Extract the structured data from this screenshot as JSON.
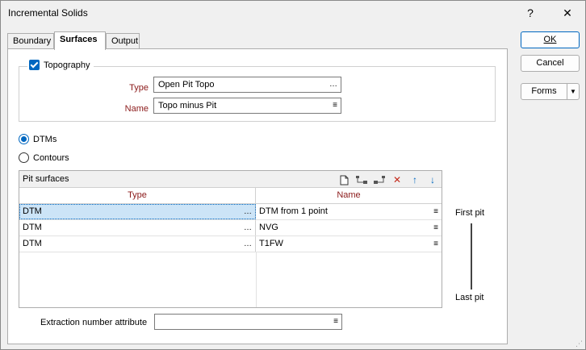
{
  "window": {
    "title": "Incremental Solids",
    "help_icon": "?",
    "close_icon": "✕"
  },
  "tabs": [
    {
      "label": "Boundary"
    },
    {
      "label": "Surfaces"
    },
    {
      "label": "Output"
    }
  ],
  "topography": {
    "label": "Topography",
    "checked": true,
    "type_label": "Type",
    "type_value": "Open Pit Topo",
    "name_label": "Name",
    "name_value": "Topo minus Pit"
  },
  "mode": {
    "dtms_label": "DTMs",
    "contours_label": "Contours",
    "selected": "DTMs"
  },
  "pit_surfaces": {
    "title": "Pit surfaces",
    "columns": {
      "type": "Type",
      "name": "Name"
    },
    "rows": [
      {
        "type": "DTM",
        "name": "DTM from 1 point"
      },
      {
        "type": "DTM",
        "name": "NVG"
      },
      {
        "type": "DTM",
        "name": "T1FW"
      }
    ],
    "first_label": "First pit",
    "last_label": "Last pit"
  },
  "extraction": {
    "label": "Extraction number attribute",
    "value": ""
  },
  "buttons": {
    "ok": "OK",
    "cancel": "Cancel",
    "forms": "Forms"
  },
  "icons": {
    "browse": "…",
    "list": "≡",
    "new_row": "🗋",
    "delete": "✕",
    "up": "↑",
    "down": "↓"
  }
}
